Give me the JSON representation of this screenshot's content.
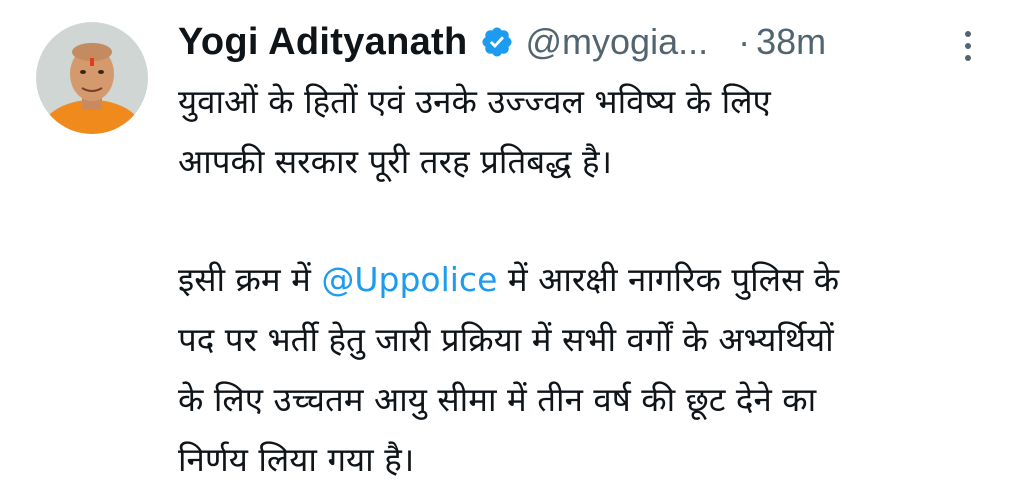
{
  "tweet": {
    "author": {
      "display_name": "Yogi Adityanath",
      "handle": "@myogia...",
      "verified_icon": "verified-badge-icon",
      "avatar_icon": "profile-avatar"
    },
    "separator": "·",
    "time": "38m",
    "more_icon": "more-vertical-icon",
    "text": {
      "para1_line1": "युवाओं के हितों एवं उनके उज्ज्वल भविष्य के लिए",
      "para1_line2": "आपकी सरकार पूरी तरह प्रतिबद्ध है।",
      "para2_line1_before": "इसी क्रम में ",
      "para2_mention": "@Uppolice",
      "para2_line1_after": " में आरक्षी नागरिक पुलिस के",
      "para2_line2": "पद पर भर्ती हेतु जारी प्रक्रिया में सभी वर्गों के अभ्यर्थियों",
      "para2_line3": "के लिए उच्चतम आयु सीमा में तीन वर्ष की छूट देने का",
      "para2_line4": "निर्णय लिया गया है।"
    },
    "colors": {
      "text": "#0f1419",
      "secondary": "#536471",
      "link": "#1d9bf0",
      "verified": "#1d9bf0"
    }
  }
}
